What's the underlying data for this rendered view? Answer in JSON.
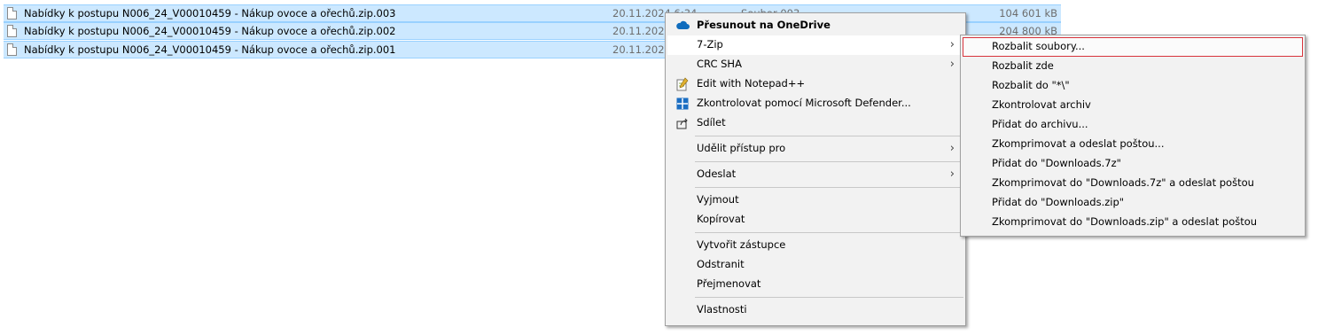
{
  "files": [
    {
      "name": "Nabídky k postupu N006_24_V00010459 - Nákup ovoce a ořechů.zip.003",
      "date": "20.11.2024 6:34",
      "type": "Soubor 003",
      "size": "104 601 kB"
    },
    {
      "name": "Nabídky k postupu N006_24_V00010459 - Nákup ovoce a ořechů.zip.002",
      "date": "20.11.2024 6",
      "type": "",
      "size": "204 800 kB"
    },
    {
      "name": "Nabídky k postupu N006_24_V00010459 - Nákup ovoce a ořechů.zip.001",
      "date": "20.11.2024 6",
      "type": "",
      "size": ""
    }
  ],
  "context_menu": {
    "onedrive": "Přesunout na OneDrive",
    "sevenzip": "7-Zip",
    "crc": "CRC SHA",
    "notepad": "Edit with Notepad++",
    "defender": "Zkontrolovat pomocí Microsoft Defender...",
    "share": "Sdílet",
    "grant_access": "Udělit přístup pro",
    "send_to": "Odeslat",
    "cut": "Vyjmout",
    "copy": "Kopírovat",
    "create_shortcut": "Vytvořit zástupce",
    "delete": "Odstranit",
    "rename": "Přejmenovat",
    "properties": "Vlastnosti"
  },
  "submenu_7zip": [
    "Rozbalit soubory...",
    "Rozbalit zde",
    "Rozbalit do \"*\\\"",
    "Zkontrolovat archiv",
    "Přidat do archivu...",
    "Zkomprimovat a odeslat poštou...",
    "Přidat do \"Downloads.7z\"",
    "Zkomprimovat do \"Downloads.7z\" a odeslat poštou",
    "Přidat do \"Downloads.zip\"",
    "Zkomprimovat do \"Downloads.zip\" a odeslat poštou"
  ],
  "icons": {
    "onedrive": "cloud-icon",
    "notepad": "notepad-icon",
    "defender": "shield-icon",
    "share": "share-icon",
    "submenu_arrow": "chevron-right-icon"
  },
  "colors": {
    "selection": "#cce8ff",
    "selection_border": "#99d1ff",
    "menu_bg": "#f2f2f2",
    "highlight_border": "#d8343c"
  }
}
